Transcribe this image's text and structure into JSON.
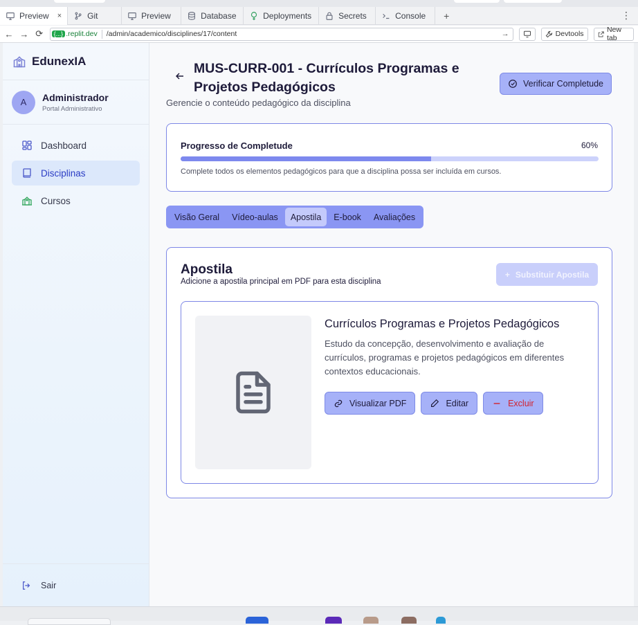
{
  "browser": {
    "tabs": [
      {
        "label": "Preview",
        "icon": "monitor-icon",
        "active": true
      },
      {
        "label": "Git",
        "icon": "git-branch-icon"
      },
      {
        "label": "Preview",
        "icon": "monitor-icon"
      },
      {
        "label": "Database",
        "icon": "database-icon"
      },
      {
        "label": "Deployments",
        "icon": "deployments-icon"
      },
      {
        "label": "Secrets",
        "icon": "lock-icon"
      },
      {
        "label": "Console",
        "icon": "terminal-icon"
      }
    ],
    "close_glyph": "×",
    "new_tab_glyph": "+",
    "more_glyph": "⋮",
    "url": {
      "host_tag": "{...}",
      "host": ".replit.dev",
      "path": "/admin/academico/disciplines/17/content"
    },
    "devtools_label": "Devtools",
    "new_tab_label": "New tab"
  },
  "sidebar": {
    "brand": "EdunexIA",
    "user": {
      "initial": "A",
      "name": "Administrador",
      "role": "Portal Administrativo"
    },
    "items": [
      {
        "label": "Dashboard",
        "icon": "grid-icon"
      },
      {
        "label": "Disciplinas",
        "icon": "book-icon",
        "active": true
      },
      {
        "label": "Cursos",
        "icon": "school-icon"
      }
    ],
    "logout_label": "Sair"
  },
  "header": {
    "title": "MUS-CURR-001 - Currículos Programas e Projetos Pedagógicos",
    "subtitle": "Gerencie o conteúdo pedagógico da disciplina",
    "verify_label": "Verificar Completude"
  },
  "progress": {
    "label": "Progresso de Completude",
    "value_text": "60%",
    "value": 0.6,
    "hint": "Complete todos os elementos pedagógicos para que a disciplina possa ser incluída em cursos."
  },
  "content_tabs": [
    {
      "label": "Visão Geral"
    },
    {
      "label": "Vídeo-aulas"
    },
    {
      "label": "Apostila",
      "active": true
    },
    {
      "label": "E-book"
    },
    {
      "label": "Avaliações"
    }
  ],
  "apostila": {
    "title": "Apostila",
    "subtitle": "Adicione a apostila principal em PDF para esta disciplina",
    "replace_label": "Substituir Apostila",
    "file": {
      "title": "Currículos Programas e Projetos Pedagógicos",
      "description": "Estudo da concepção, desenvolvimento e avaliação de currículos, programas e projetos pedagógicos em diferentes contextos educacionais.",
      "view_label": "Visualizar PDF",
      "edit_label": "Editar",
      "delete_label": "Excluir"
    }
  },
  "colors": {
    "accent": "#8a96f3",
    "accent_border": "#7d87e6",
    "danger": "#d2222d",
    "sidebar_active": "#dce8fb"
  }
}
